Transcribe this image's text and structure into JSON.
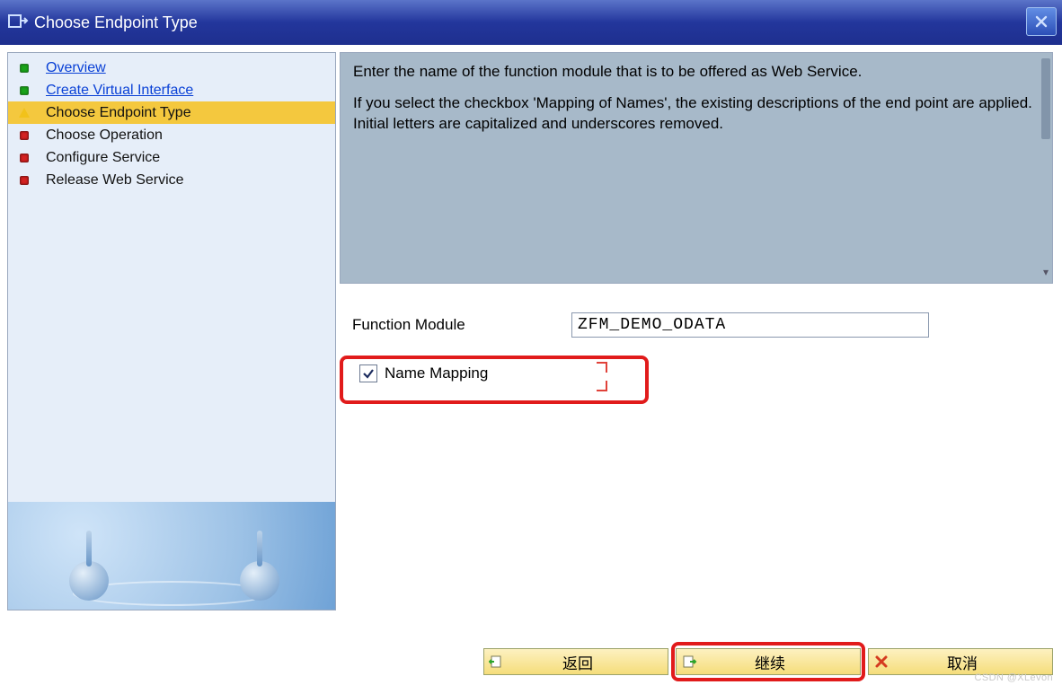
{
  "titlebar": {
    "title": "Choose Endpoint Type"
  },
  "sidebar": {
    "items": [
      {
        "label": "Overview",
        "status": "green",
        "link": true,
        "active": false
      },
      {
        "label": "Create Virtual Interface",
        "status": "green",
        "link": true,
        "active": false
      },
      {
        "label": "Choose Endpoint Type",
        "status": "yellow",
        "link": false,
        "active": true
      },
      {
        "label": "Choose Operation",
        "status": "red",
        "link": false,
        "active": false
      },
      {
        "label": "Configure Service",
        "status": "red",
        "link": false,
        "active": false
      },
      {
        "label": "Release Web Service",
        "status": "red",
        "link": false,
        "active": false
      }
    ]
  },
  "description": {
    "p1": "Enter the name of the function module that is to be offered as Web Service.",
    "p2": "If you select the checkbox 'Mapping of Names', the existing descriptions of the end point are applied. Initial letters are capitalized and underscores removed."
  },
  "form": {
    "function_module_label": "Function Module",
    "function_module_value": "ZFM_DEMO_ODATA",
    "name_mapping_label": "Name Mapping",
    "name_mapping_checked": true
  },
  "buttons": {
    "back": "返回",
    "continue": "继续",
    "cancel": "取消"
  },
  "watermark": "CSDN @XLevon"
}
